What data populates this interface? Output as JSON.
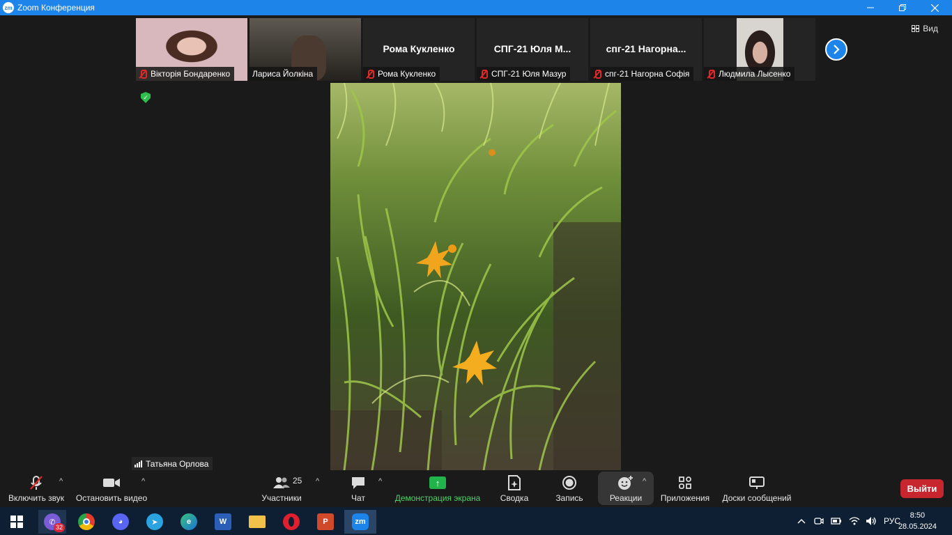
{
  "window": {
    "app_logo": "zm",
    "title": "Zoom Конференция",
    "controls": [
      "minimize-icon",
      "restore-icon",
      "close-icon"
    ]
  },
  "participants_strip": [
    {
      "name": "Вікторія Бондаренко",
      "big_name": "",
      "muted": true,
      "has_video": true
    },
    {
      "name": "Лариса Йолкіна",
      "big_name": "",
      "muted": false,
      "has_video": true
    },
    {
      "name": "Рома Кукленко",
      "big_name": "Рома Кукленко",
      "muted": true,
      "has_video": false
    },
    {
      "name": "СПГ-21 Юля Мазур",
      "big_name": "СПГ-21  Юля  М...",
      "muted": true,
      "has_video": false
    },
    {
      "name": "спг-21 Нагорна Софія",
      "big_name": "спг-21  Нагорна...",
      "muted": true,
      "has_video": false
    },
    {
      "name": "Людмила Лысенко",
      "big_name": "",
      "muted": true,
      "has_video": true
    }
  ],
  "view_button": {
    "label": "Вид"
  },
  "active_speaker": {
    "name": "Татьяна Орлова"
  },
  "toolbar": {
    "unmute": "Включить звук",
    "stop_video": "Остановить видео",
    "participants": "Участники",
    "participants_count": "25",
    "chat": "Чат",
    "share_screen": "Демонстрация экрана",
    "summary": "Сводка",
    "record": "Запись",
    "reactions": "Реакции",
    "apps": "Приложения",
    "whiteboards": "Доски сообщений",
    "leave": "Выйти"
  },
  "colors": {
    "accent": "#1d85e9",
    "share_green": "#21b44a",
    "leave_red": "#c8262f",
    "mute_red": "#e02828"
  },
  "taskbar": {
    "apps": [
      "windows-start",
      "viber",
      "chrome",
      "discord",
      "telegram",
      "edge",
      "word",
      "file-explorer",
      "opera",
      "powerpoint",
      "zoom"
    ],
    "viber_badge": "32",
    "zoom_label": "zm",
    "language": "РУС",
    "time": "8:50",
    "date": "28.05.2024"
  }
}
